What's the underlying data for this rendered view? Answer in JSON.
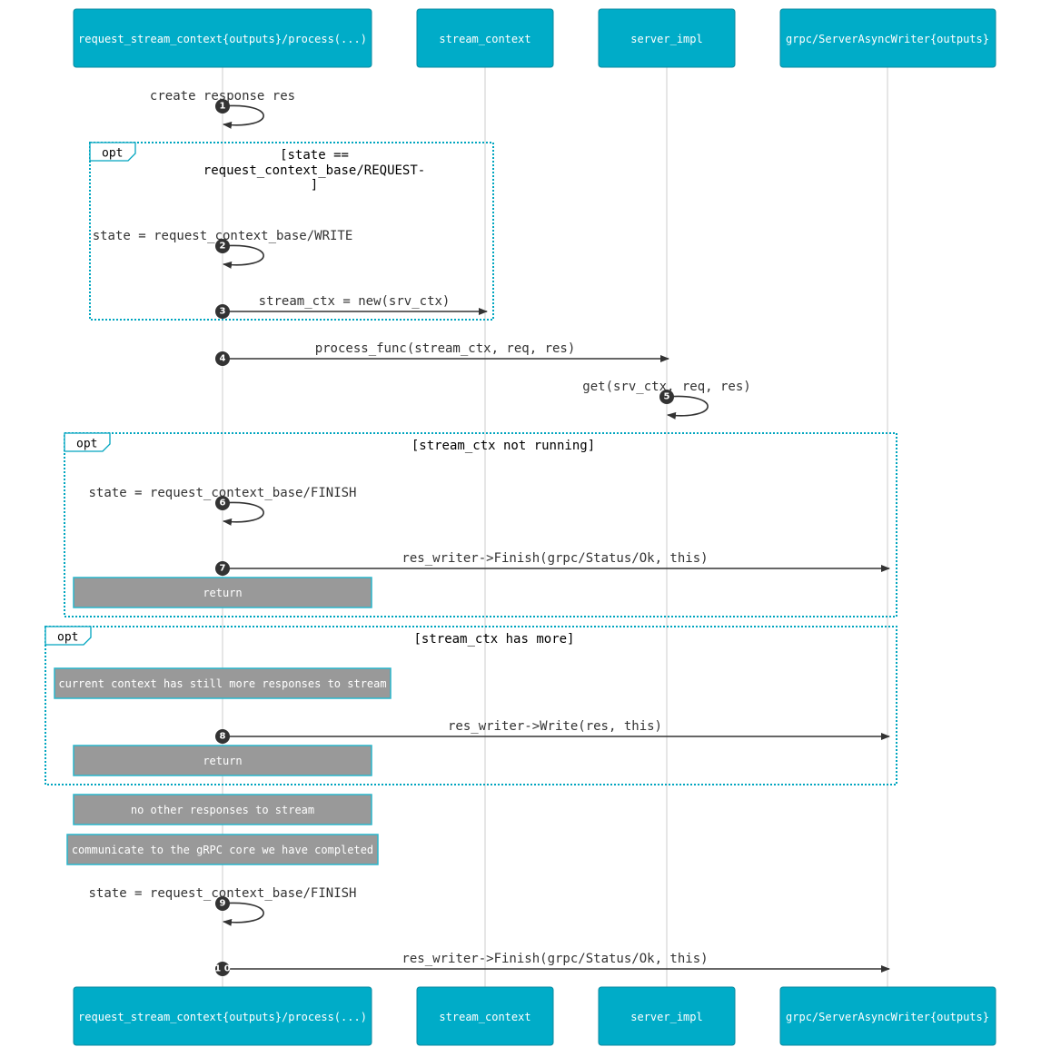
{
  "actors": [
    {
      "id": "rsc",
      "label": "request_stream_context{outputs}/process(...)"
    },
    {
      "id": "sc",
      "label": "stream_context"
    },
    {
      "id": "si",
      "label": "server_impl"
    },
    {
      "id": "saw",
      "label": "grpc/ServerAsyncWriter{outputs}"
    }
  ],
  "messages": [
    {
      "seq": "1",
      "from": "rsc",
      "to": "rsc",
      "type": "self",
      "label": "create response res"
    },
    {
      "seq": "2",
      "from": "rsc",
      "to": "rsc",
      "type": "self",
      "label": "state = request_context_base/WRITE"
    },
    {
      "seq": "3",
      "from": "rsc",
      "to": "sc",
      "type": "arrow",
      "label": "stream_ctx = new(srv_ctx)"
    },
    {
      "seq": "4",
      "from": "rsc",
      "to": "si",
      "type": "arrow",
      "label": "process_func(stream_ctx, req, res)"
    },
    {
      "seq": "5",
      "from": "si",
      "to": "si",
      "type": "self",
      "label": "get(srv_ctx, req, res)"
    },
    {
      "seq": "6",
      "from": "rsc",
      "to": "rsc",
      "type": "self",
      "label": "state = request_context_base/FINISH"
    },
    {
      "seq": "7",
      "from": "rsc",
      "to": "saw",
      "type": "arrow",
      "label": "res_writer->Finish(grpc/Status/Ok, this)"
    },
    {
      "seq": "8",
      "from": "rsc",
      "to": "saw",
      "type": "arrow",
      "label": "res_writer->Write(res, this)"
    },
    {
      "seq": "9",
      "from": "rsc",
      "to": "rsc",
      "type": "self",
      "label": "state = request_context_base/FINISH"
    },
    {
      "seq": "1 0",
      "from": "rsc",
      "to": "saw",
      "type": "arrow",
      "label": "res_writer->Finish(grpc/Status/Ok, this)"
    }
  ],
  "frames": [
    {
      "kind": "opt",
      "condition_lines": [
        "[state ==",
        "request_context_base/REQUEST-",
        "]"
      ]
    },
    {
      "kind": "opt",
      "condition_lines": [
        "[stream_ctx not running]"
      ]
    },
    {
      "kind": "opt",
      "condition_lines": [
        "[stream_ctx has more]"
      ]
    }
  ],
  "notes": [
    {
      "label": "return"
    },
    {
      "label": "current context has still more responses to stream"
    },
    {
      "label": "return"
    },
    {
      "label": "no other responses to stream"
    },
    {
      "label": "communicate to the gRPC core we have completed"
    }
  ],
  "colors": {
    "actor_fill": "#00acc8",
    "frame_border": "#00a5bf",
    "note_fill": "#999999",
    "message_line": "#333333"
  }
}
